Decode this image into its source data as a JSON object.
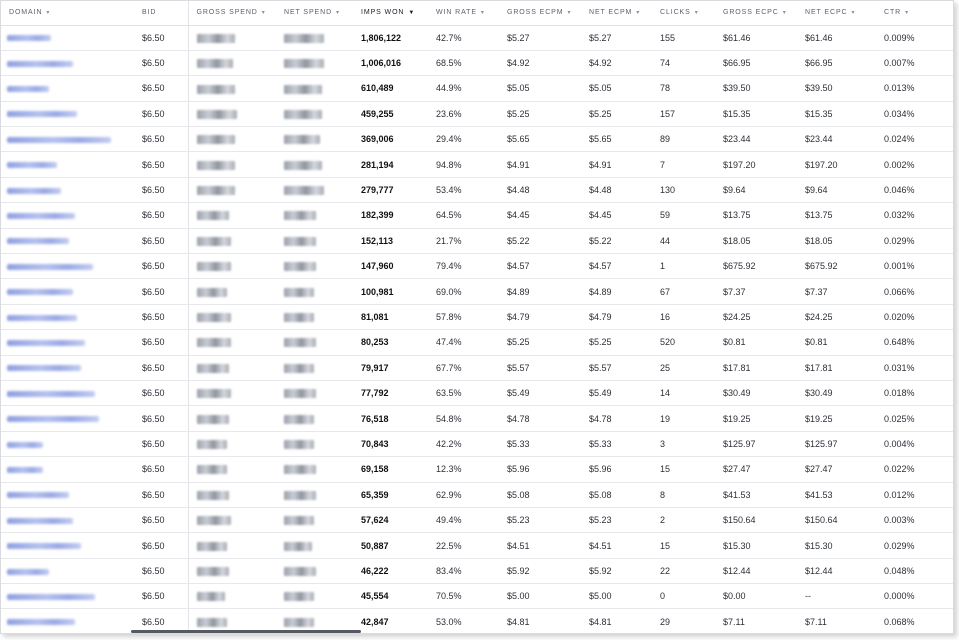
{
  "table": {
    "columns": [
      {
        "key": "domain",
        "label": "DOMAIN"
      },
      {
        "key": "bid",
        "label": "BID"
      },
      {
        "key": "gross_spend",
        "label": "GROSS SPEND"
      },
      {
        "key": "net_spend",
        "label": "NET SPEND"
      },
      {
        "key": "imps_won",
        "label": "IMPS WON"
      },
      {
        "key": "win_rate",
        "label": "WIN RATE"
      },
      {
        "key": "gross_ecpm",
        "label": "GROSS ECPM"
      },
      {
        "key": "net_ecpm",
        "label": "NET ECPM"
      },
      {
        "key": "clicks",
        "label": "CLICKS"
      },
      {
        "key": "gross_ecpc",
        "label": "GROSS ECPC"
      },
      {
        "key": "net_ecpc",
        "label": "NET ECPC"
      },
      {
        "key": "ctr",
        "label": "CTR"
      }
    ],
    "sorted_column": "imps_won",
    "sort_icon": "sort-arrow-icon",
    "sort_active_icon": "sort-descending-icon",
    "rows": [
      {
        "bid": "$6.50",
        "imps": "1,806,122",
        "win": "42.7%",
        "gecpm": "$5.27",
        "necpm": "$5.27",
        "clicks": "155",
        "gecpc": "$61.46",
        "necpc": "$61.46",
        "ctr": "0.009%"
      },
      {
        "bid": "$6.50",
        "imps": "1,006,016",
        "win": "68.5%",
        "gecpm": "$4.92",
        "necpm": "$4.92",
        "clicks": "74",
        "gecpc": "$66.95",
        "necpc": "$66.95",
        "ctr": "0.007%"
      },
      {
        "bid": "$6.50",
        "imps": "610,489",
        "win": "44.9%",
        "gecpm": "$5.05",
        "necpm": "$5.05",
        "clicks": "78",
        "gecpc": "$39.50",
        "necpc": "$39.50",
        "ctr": "0.013%"
      },
      {
        "bid": "$6.50",
        "imps": "459,255",
        "win": "23.6%",
        "gecpm": "$5.25",
        "necpm": "$5.25",
        "clicks": "157",
        "gecpc": "$15.35",
        "necpc": "$15.35",
        "ctr": "0.034%"
      },
      {
        "bid": "$6.50",
        "imps": "369,006",
        "win": "29.4%",
        "gecpm": "$5.65",
        "necpm": "$5.65",
        "clicks": "89",
        "gecpc": "$23.44",
        "necpc": "$23.44",
        "ctr": "0.024%"
      },
      {
        "bid": "$6.50",
        "imps": "281,194",
        "win": "94.8%",
        "gecpm": "$4.91",
        "necpm": "$4.91",
        "clicks": "7",
        "gecpc": "$197.20",
        "necpc": "$197.20",
        "ctr": "0.002%"
      },
      {
        "bid": "$6.50",
        "imps": "279,777",
        "win": "53.4%",
        "gecpm": "$4.48",
        "necpm": "$4.48",
        "clicks": "130",
        "gecpc": "$9.64",
        "necpc": "$9.64",
        "ctr": "0.046%"
      },
      {
        "bid": "$6.50",
        "imps": "182,399",
        "win": "64.5%",
        "gecpm": "$4.45",
        "necpm": "$4.45",
        "clicks": "59",
        "gecpc": "$13.75",
        "necpc": "$13.75",
        "ctr": "0.032%"
      },
      {
        "bid": "$6.50",
        "imps": "152,113",
        "win": "21.7%",
        "gecpm": "$5.22",
        "necpm": "$5.22",
        "clicks": "44",
        "gecpc": "$18.05",
        "necpc": "$18.05",
        "ctr": "0.029%"
      },
      {
        "bid": "$6.50",
        "imps": "147,960",
        "win": "79.4%",
        "gecpm": "$4.57",
        "necpm": "$4.57",
        "clicks": "1",
        "gecpc": "$675.92",
        "necpc": "$675.92",
        "ctr": "0.001%"
      },
      {
        "bid": "$6.50",
        "imps": "100,981",
        "win": "69.0%",
        "gecpm": "$4.89",
        "necpm": "$4.89",
        "clicks": "67",
        "gecpc": "$7.37",
        "necpc": "$7.37",
        "ctr": "0.066%"
      },
      {
        "bid": "$6.50",
        "imps": "81,081",
        "win": "57.8%",
        "gecpm": "$4.79",
        "necpm": "$4.79",
        "clicks": "16",
        "gecpc": "$24.25",
        "necpc": "$24.25",
        "ctr": "0.020%"
      },
      {
        "bid": "$6.50",
        "imps": "80,253",
        "win": "47.4%",
        "gecpm": "$5.25",
        "necpm": "$5.25",
        "clicks": "520",
        "gecpc": "$0.81",
        "necpc": "$0.81",
        "ctr": "0.648%"
      },
      {
        "bid": "$6.50",
        "imps": "79,917",
        "win": "67.7%",
        "gecpm": "$5.57",
        "necpm": "$5.57",
        "clicks": "25",
        "gecpc": "$17.81",
        "necpc": "$17.81",
        "ctr": "0.031%"
      },
      {
        "bid": "$6.50",
        "imps": "77,792",
        "win": "63.5%",
        "gecpm": "$5.49",
        "necpm": "$5.49",
        "clicks": "14",
        "gecpc": "$30.49",
        "necpc": "$30.49",
        "ctr": "0.018%"
      },
      {
        "bid": "$6.50",
        "imps": "76,518",
        "win": "54.8%",
        "gecpm": "$4.78",
        "necpm": "$4.78",
        "clicks": "19",
        "gecpc": "$19.25",
        "necpc": "$19.25",
        "ctr": "0.025%"
      },
      {
        "bid": "$6.50",
        "imps": "70,843",
        "win": "42.2%",
        "gecpm": "$5.33",
        "necpm": "$5.33",
        "clicks": "3",
        "gecpc": "$125.97",
        "necpc": "$125.97",
        "ctr": "0.004%"
      },
      {
        "bid": "$6.50",
        "imps": "69,158",
        "win": "12.3%",
        "gecpm": "$5.96",
        "necpm": "$5.96",
        "clicks": "15",
        "gecpc": "$27.47",
        "necpc": "$27.47",
        "ctr": "0.022%"
      },
      {
        "bid": "$6.50",
        "imps": "65,359",
        "win": "62.9%",
        "gecpm": "$5.08",
        "necpm": "$5.08",
        "clicks": "8",
        "gecpc": "$41.53",
        "necpc": "$41.53",
        "ctr": "0.012%"
      },
      {
        "bid": "$6.50",
        "imps": "57,624",
        "win": "49.4%",
        "gecpm": "$5.23",
        "necpm": "$5.23",
        "clicks": "2",
        "gecpc": "$150.64",
        "necpc": "$150.64",
        "ctr": "0.003%"
      },
      {
        "bid": "$6.50",
        "imps": "50,887",
        "win": "22.5%",
        "gecpm": "$4.51",
        "necpm": "$4.51",
        "clicks": "15",
        "gecpc": "$15.30",
        "necpc": "$15.30",
        "ctr": "0.029%"
      },
      {
        "bid": "$6.50",
        "imps": "46,222",
        "win": "83.4%",
        "gecpm": "$5.92",
        "necpm": "$5.92",
        "clicks": "22",
        "gecpc": "$12.44",
        "necpc": "$12.44",
        "ctr": "0.048%"
      },
      {
        "bid": "$6.50",
        "imps": "45,554",
        "win": "70.5%",
        "gecpm": "$5.00",
        "necpm": "$5.00",
        "clicks": "0",
        "gecpc": "$0.00",
        "necpc": "--",
        "ctr": "0.000%"
      },
      {
        "bid": "$6.50",
        "imps": "42,847",
        "win": "53.0%",
        "gecpm": "$4.81",
        "necpm": "$4.81",
        "clicks": "29",
        "gecpc": "$7.11",
        "necpc": "$7.11",
        "ctr": "0.068%"
      }
    ]
  }
}
